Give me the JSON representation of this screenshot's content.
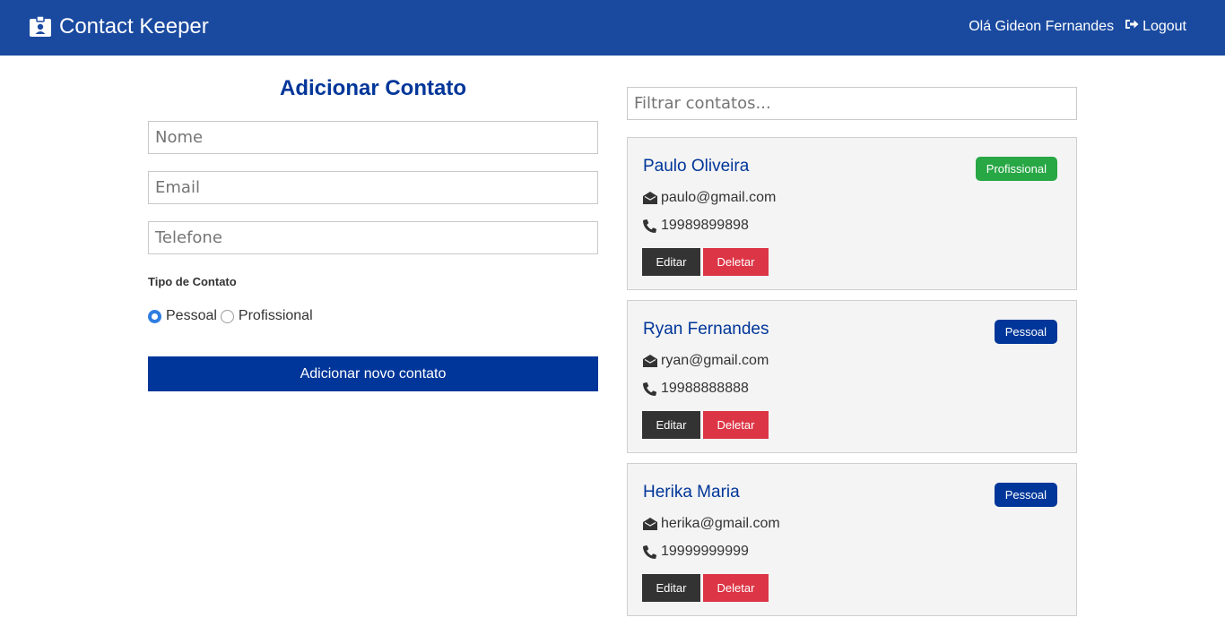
{
  "navbar": {
    "brand": "Contact Keeper",
    "greeting": "Olá Gideon Fernandes",
    "logout_label": "Logout",
    "brand_icon": "id-badge-icon",
    "logout_icon": "sign-out-icon"
  },
  "form": {
    "title": "Adicionar Contato",
    "name_placeholder": "Nome",
    "email_placeholder": "Email",
    "phone_placeholder": "Telefone",
    "type_label": "Tipo de Contato",
    "options": [
      {
        "label": "Pessoal",
        "checked": true
      },
      {
        "label": "Profissional",
        "checked": false
      }
    ],
    "submit_label": "Adicionar novo contato"
  },
  "filter": {
    "placeholder": "Filtrar contatos..."
  },
  "contacts": [
    {
      "name": "Paulo Oliveira",
      "email": "paulo@gmail.com",
      "phone": "19989899898",
      "type": "Profissional",
      "type_color": "#28a745"
    },
    {
      "name": "Ryan Fernandes",
      "email": "ryan@gmail.com",
      "phone": "19988888888",
      "type": "Pessoal",
      "type_color": "#003699"
    },
    {
      "name": "Herika Maria",
      "email": "herika@gmail.com",
      "phone": "19999999999",
      "type": "Pessoal",
      "type_color": "#003699"
    }
  ],
  "card_actions": {
    "edit_label": "Editar",
    "delete_label": "Deletar"
  },
  "colors": {
    "navbar": "#1a4aa0",
    "primary": "#003699",
    "success": "#28a745",
    "danger": "#dc3545",
    "dark": "#333333"
  }
}
